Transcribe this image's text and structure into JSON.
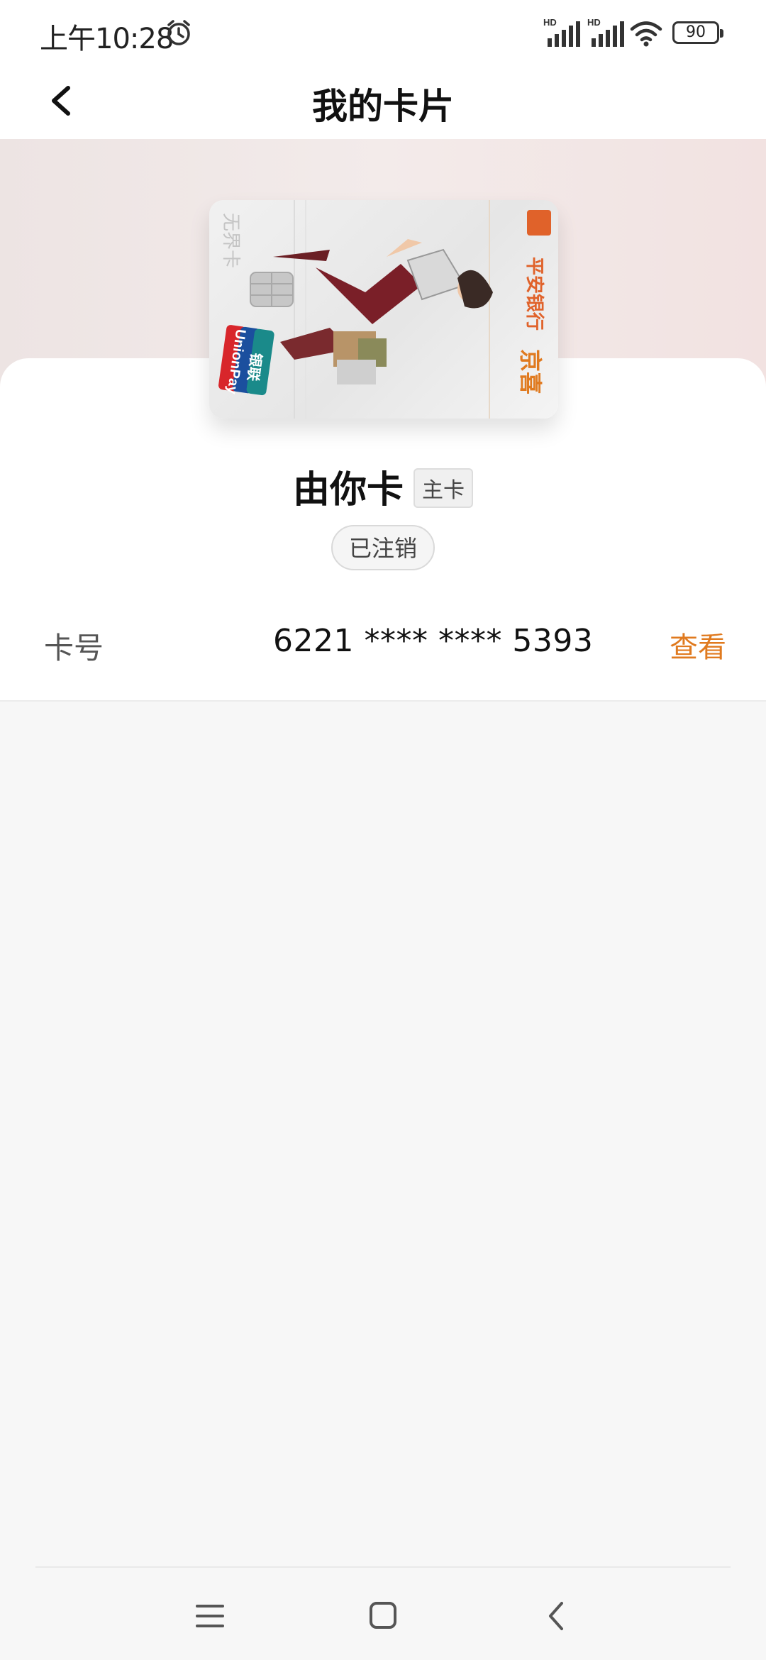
{
  "status_bar": {
    "time": "上午10:28",
    "battery": "90",
    "signal_label": "HD"
  },
  "header": {
    "title": "我的卡片"
  },
  "card": {
    "name": "由你卡",
    "role_badge": "主卡",
    "status": "已注销",
    "card_art": {
      "bank_name": "平安银行",
      "cobrand": "京喜",
      "card_series": "无界卡",
      "network_en": "UnionPay",
      "network_cn": "银联"
    }
  },
  "card_number": {
    "label": "卡号",
    "value": "6221 **** **** 5393",
    "action": "查看"
  },
  "colors": {
    "accent": "#e07a1f",
    "background": "#f7f7f7"
  },
  "icons": {
    "back": "chevron-left-icon",
    "nav_menu": "menu-icon",
    "nav_home": "home-icon",
    "nav_back": "back-icon"
  }
}
